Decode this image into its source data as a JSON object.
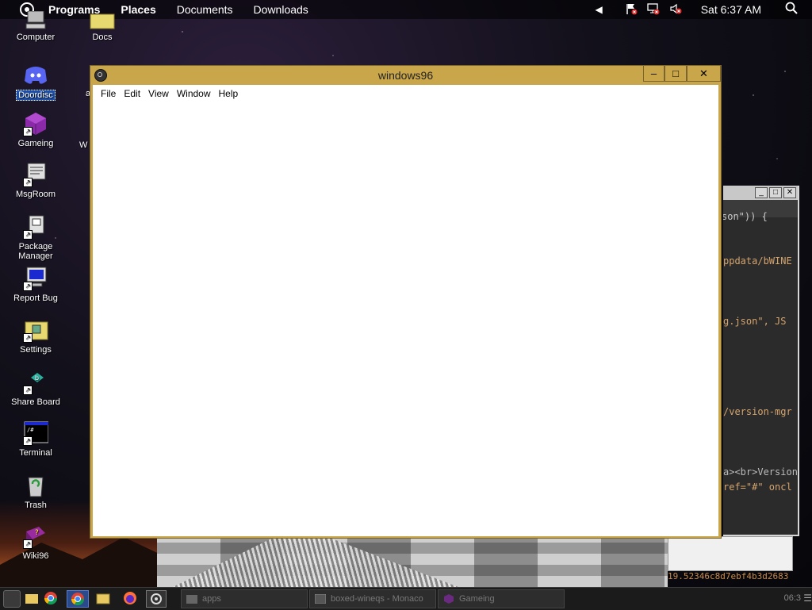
{
  "top_panel": {
    "menus": [
      "Programs",
      "Places",
      "Documents",
      "Downloads"
    ],
    "clock": "Sat 6:37 AM"
  },
  "desktop": {
    "icons": [
      {
        "label": "Computer"
      },
      {
        "label": "Docs"
      },
      {
        "label": "Doordisc"
      },
      {
        "label": "Gameing"
      },
      {
        "label": "MsgRoom"
      },
      {
        "label": "Package Manager"
      },
      {
        "label": "Report Bug"
      },
      {
        "label": "Settings"
      },
      {
        "label": "Share Board"
      },
      {
        "label": "Terminal"
      },
      {
        "label": "Trash"
      },
      {
        "label": "Wiki96"
      }
    ],
    "partial_labels": [
      "W",
      "a"
    ]
  },
  "window": {
    "title": "windows96",
    "menu": [
      "File",
      "Edit",
      "View",
      "Window",
      "Help"
    ],
    "controls": {
      "minimize": "–",
      "maximize": "□",
      "close": "✕"
    }
  },
  "code_window": {
    "lines": [
      "son\")) {",
      "ppdata/bWINE",
      "g.json\", JS",
      "/version-mgr",
      "a><br>Version",
      "ref=\"#\" oncl"
    ]
  },
  "hash_text": "19.52346c8d7ebf4b3d2683",
  "taskbar": {
    "tasks": [
      "apps",
      "boxed-wineqs - Monaco",
      "Gameing"
    ],
    "clock": "06:3"
  },
  "colors": {
    "window_frame": "#c9a64a",
    "selected_icon": "#1e4fa8"
  }
}
